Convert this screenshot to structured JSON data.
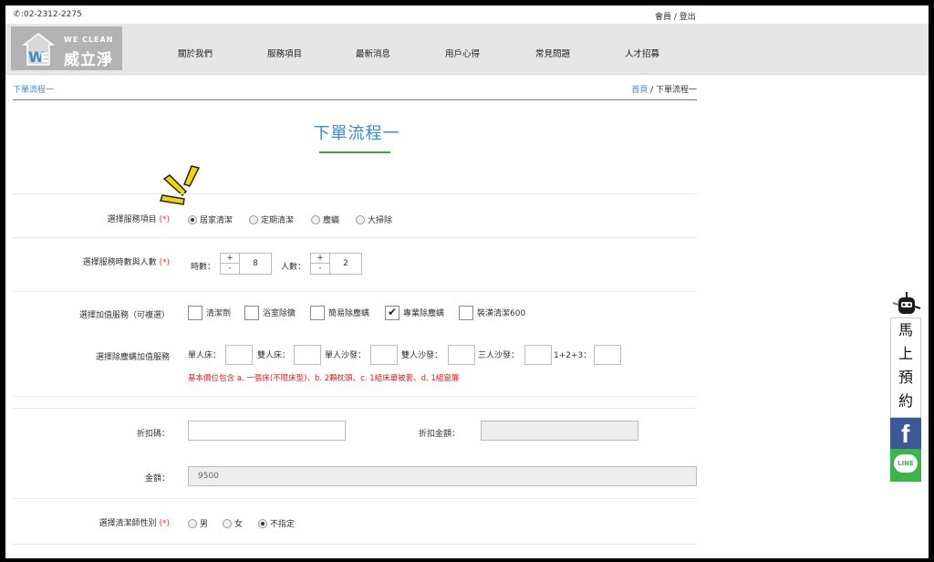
{
  "topbar": {
    "phone": ":02-2312-2275",
    "member": "會員",
    "sep": " / ",
    "logout": "登出"
  },
  "logo": {
    "en": "WE CLEAN",
    "zh": "威立淨"
  },
  "nav": [
    "關於我們",
    "服務項目",
    "最新消息",
    "用戶心得",
    "常見問題",
    "人才招募"
  ],
  "breadcrumb": {
    "current": "下單流程一",
    "home": "首頁",
    "sep": " / "
  },
  "page_title": "下單流程一",
  "service": {
    "label": "選擇服務項目",
    "req": "(*)",
    "options": [
      "居家清潔",
      "定期清潔",
      "塵蟎",
      "大掃除"
    ],
    "selected": 0
  },
  "hours": {
    "label": "選擇服務時數與人數",
    "req": "(*)",
    "hours_label": "時數：",
    "hours_value": "8",
    "people_label": "人數：",
    "people_value": "2",
    "plus": "+",
    "minus": "-"
  },
  "addons": {
    "label": "選擇加值服務（可複選）",
    "items": [
      {
        "label": "清潔劑",
        "checked": false
      },
      {
        "label": "浴室除黴",
        "checked": false
      },
      {
        "label": "簡易除塵螨",
        "checked": false
      },
      {
        "label": "專業除塵螨",
        "checked": true
      },
      {
        "label": "裝潢清潔600",
        "checked": false
      }
    ]
  },
  "mite": {
    "label": "選擇除塵螨加值服務",
    "fields": [
      "單人床：",
      "雙人床：",
      "單人沙發：",
      "雙人沙發：",
      "三人沙發：",
      "1+2+3："
    ],
    "note": "基本價位包含 a. 一張床(不限床型)、b. 2顆枕頭、c. 1組床單被套、d. 1組窗簾"
  },
  "discount": {
    "label": "折扣碼：",
    "amount_label": "折扣金額：",
    "code_value": "",
    "amount_value": ""
  },
  "amount": {
    "label": "金額：",
    "value": "9500"
  },
  "gender": {
    "label": "選擇清潔師性別",
    "req": "(*)",
    "options": [
      "男",
      "女",
      "不指定"
    ],
    "selected": 2
  },
  "side": {
    "book": [
      "馬",
      "上",
      "預",
      "約"
    ],
    "fb": "f",
    "line": "LINE"
  },
  "colors": {
    "accent": "#3d8bc8",
    "green": "#43a047",
    "required": "#d33",
    "facebook": "#3b5998",
    "line": "#3ab54a"
  }
}
